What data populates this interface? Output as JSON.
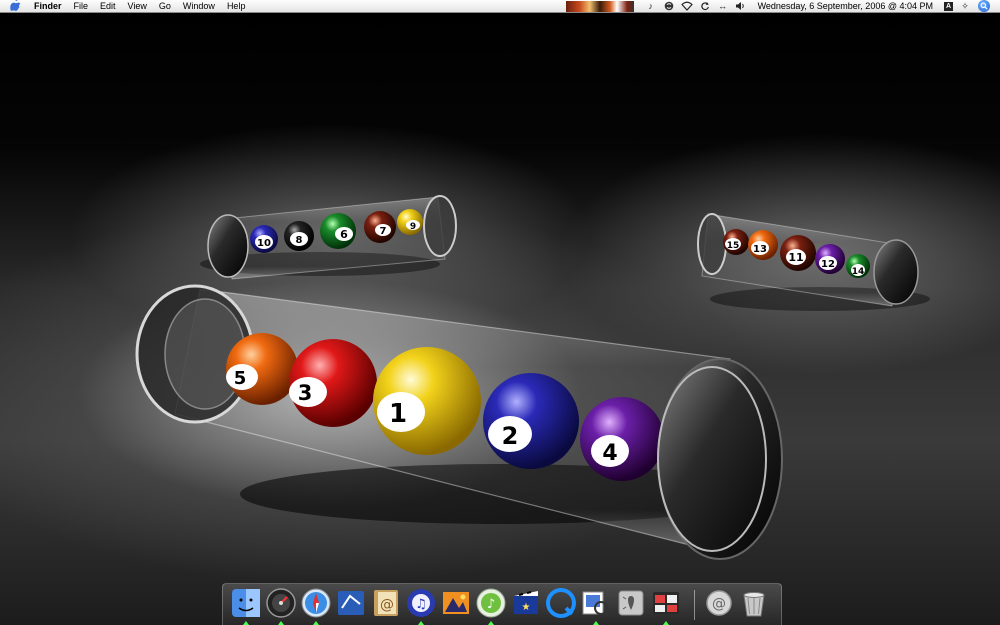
{
  "menubar": {
    "app_name": "Finder",
    "items": [
      "File",
      "Edit",
      "View",
      "Go",
      "Window",
      "Help"
    ],
    "clock": "Wednesday, 6 September, 2006 @ 4:04 PM"
  },
  "status_icons": [
    "itunes-note-icon",
    "script-icon",
    "wifi-icon",
    "sync-icon",
    "network-arrows-icon",
    "volume-icon",
    "input-menu-icon",
    "display-icon"
  ],
  "desktop": {
    "balls_large": [
      "5",
      "3",
      "1",
      "2",
      "4"
    ],
    "balls_top_left": [
      "10",
      "8",
      "6",
      "7",
      "9"
    ],
    "balls_top_right": [
      "15",
      "13",
      "11",
      "12",
      "14"
    ]
  },
  "dock": {
    "apps": [
      {
        "name": "Finder",
        "running": true
      },
      {
        "name": "Dashboard",
        "running": true
      },
      {
        "name": "Safari",
        "running": true
      },
      {
        "name": "Mail",
        "running": false
      },
      {
        "name": "Address Book",
        "running": false
      },
      {
        "name": "iTunes",
        "running": true
      },
      {
        "name": "iPhoto",
        "running": false
      },
      {
        "name": "iTunes Music",
        "running": true
      },
      {
        "name": "iMovie",
        "running": false
      },
      {
        "name": "QuickTime",
        "running": false
      },
      {
        "name": "Preview",
        "running": true
      },
      {
        "name": "System Preferences",
        "running": false
      },
      {
        "name": "Photo Booth",
        "running": true
      }
    ],
    "other": [
      "Mail Downloads",
      "Trash"
    ]
  },
  "colors": {
    "menubar_bg": "#ececec",
    "ball_yellow": "#f2d21a",
    "ball_blue": "#2a2ab8",
    "ball_red": "#e01818",
    "ball_purple": "#6b1fa8",
    "ball_orange": "#f06a10",
    "ball_green": "#1a8a2a",
    "ball_maroon": "#7a2010"
  }
}
